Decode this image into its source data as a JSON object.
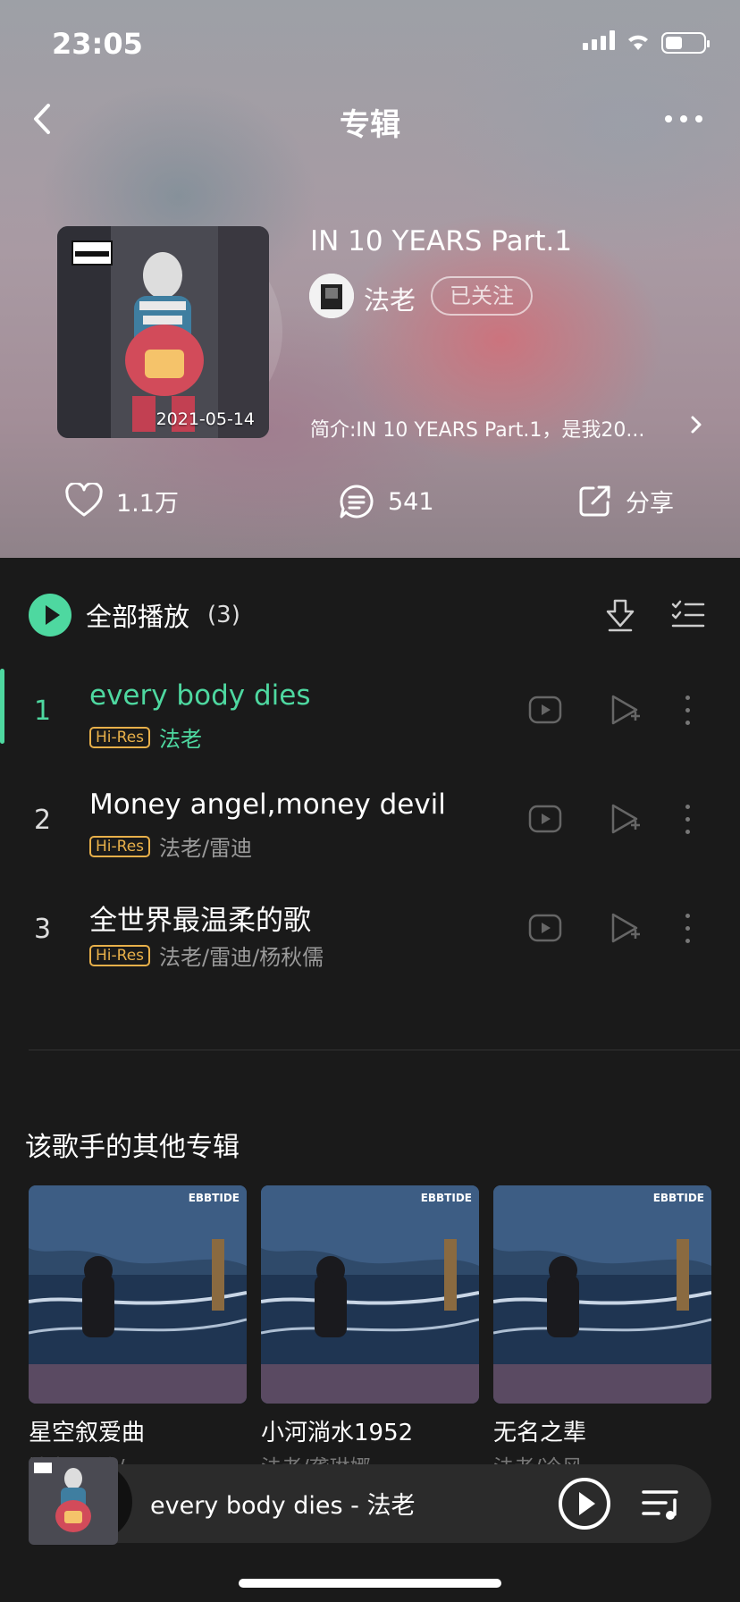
{
  "status_bar": {
    "time": "23:05"
  },
  "nav": {
    "title": "专辑"
  },
  "album": {
    "title": "IN 10 YEARS Part.1",
    "cover_date": "2021-05-14",
    "artist": "法老",
    "follow_label": "已关注",
    "intro": "简介:IN 10 YEARS Part.1，是我20..."
  },
  "actions": {
    "likes": "1.1万",
    "comments": "541",
    "share": "分享"
  },
  "playall": {
    "label": "全部播放",
    "count": "(3)"
  },
  "tracks": [
    {
      "num": "1",
      "title": "every body dies",
      "badge": "Hi-Res",
      "artists": "法老"
    },
    {
      "num": "2",
      "title": "Money angel,money devil",
      "badge": "Hi-Res",
      "artists": "法老/雷迪"
    },
    {
      "num": "3",
      "title": "全世界最温柔的歌",
      "badge": "Hi-Res",
      "artists": "法老/雷迪/杨秋儒"
    }
  ],
  "other_albums": {
    "title": "该歌手的其他专辑",
    "items": [
      {
        "name": "星空叙爱曲",
        "artist": "法老/雷迪/…",
        "cover_text": "EBBTIDE"
      },
      {
        "name": "小河淌水1952",
        "artist": "法老/龚琳娜",
        "cover_text": "EBBTIDE"
      },
      {
        "name": "无名之辈",
        "artist": "法老/冷风",
        "cover_text": "EBBTIDE"
      }
    ]
  },
  "mini_player": {
    "title": "every body dies - 法老"
  },
  "colors": {
    "accent": "#4ed8a0",
    "hires": "#e8b04a",
    "background": "#1a1a1a"
  }
}
